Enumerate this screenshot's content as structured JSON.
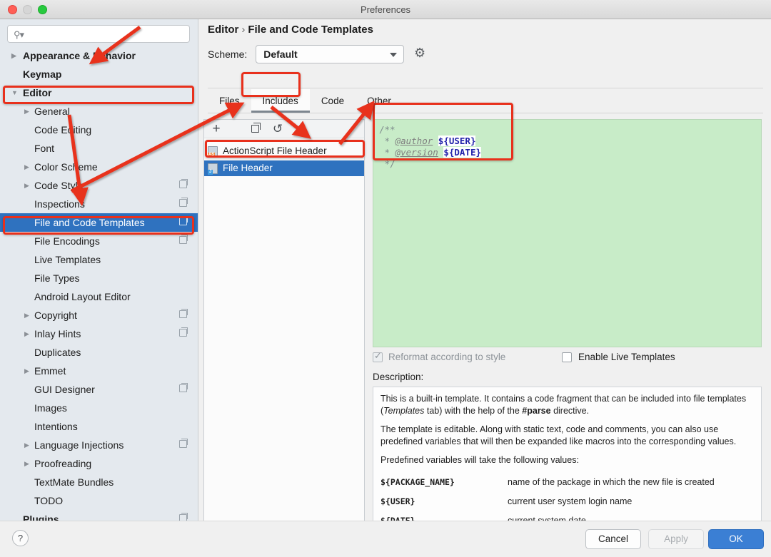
{
  "window": {
    "title": "Preferences",
    "traffic_lights": [
      "close-button",
      "minimize-button",
      "zoom-button"
    ]
  },
  "sidebar": {
    "search": {
      "value": "",
      "placeholder": "",
      "icon": "search-icon"
    },
    "items": [
      {
        "label": "Appearance & Behavior",
        "level": 0,
        "arrow": "collapsed",
        "bold": true,
        "selected": false,
        "copyable": false
      },
      {
        "label": "Keymap",
        "level": 0,
        "arrow": "none",
        "bold": true,
        "selected": false,
        "copyable": false
      },
      {
        "label": "Editor",
        "level": 0,
        "arrow": "expanded",
        "bold": true,
        "selected": false,
        "copyable": false
      },
      {
        "label": "General",
        "level": 1,
        "arrow": "collapsed",
        "bold": false,
        "selected": false,
        "copyable": false
      },
      {
        "label": "Code Editing",
        "level": 1,
        "arrow": "none",
        "bold": false,
        "selected": false,
        "copyable": false
      },
      {
        "label": "Font",
        "level": 1,
        "arrow": "none",
        "bold": false,
        "selected": false,
        "copyable": false
      },
      {
        "label": "Color Scheme",
        "level": 1,
        "arrow": "collapsed",
        "bold": false,
        "selected": false,
        "copyable": false
      },
      {
        "label": "Code Style",
        "level": 1,
        "arrow": "collapsed",
        "bold": false,
        "selected": false,
        "copyable": true
      },
      {
        "label": "Inspections",
        "level": 1,
        "arrow": "none",
        "bold": false,
        "selected": false,
        "copyable": true
      },
      {
        "label": "File and Code Templates",
        "level": 1,
        "arrow": "none",
        "bold": false,
        "selected": true,
        "copyable": true
      },
      {
        "label": "File Encodings",
        "level": 1,
        "arrow": "none",
        "bold": false,
        "selected": false,
        "copyable": true
      },
      {
        "label": "Live Templates",
        "level": 1,
        "arrow": "none",
        "bold": false,
        "selected": false,
        "copyable": false
      },
      {
        "label": "File Types",
        "level": 1,
        "arrow": "none",
        "bold": false,
        "selected": false,
        "copyable": false
      },
      {
        "label": "Android Layout Editor",
        "level": 1,
        "arrow": "none",
        "bold": false,
        "selected": false,
        "copyable": false
      },
      {
        "label": "Copyright",
        "level": 1,
        "arrow": "collapsed",
        "bold": false,
        "selected": false,
        "copyable": true
      },
      {
        "label": "Inlay Hints",
        "level": 1,
        "arrow": "collapsed",
        "bold": false,
        "selected": false,
        "copyable": true
      },
      {
        "label": "Duplicates",
        "level": 1,
        "arrow": "none",
        "bold": false,
        "selected": false,
        "copyable": false
      },
      {
        "label": "Emmet",
        "level": 1,
        "arrow": "collapsed",
        "bold": false,
        "selected": false,
        "copyable": false
      },
      {
        "label": "GUI Designer",
        "level": 1,
        "arrow": "none",
        "bold": false,
        "selected": false,
        "copyable": true
      },
      {
        "label": "Images",
        "level": 1,
        "arrow": "none",
        "bold": false,
        "selected": false,
        "copyable": false
      },
      {
        "label": "Intentions",
        "level": 1,
        "arrow": "none",
        "bold": false,
        "selected": false,
        "copyable": false
      },
      {
        "label": "Language Injections",
        "level": 1,
        "arrow": "collapsed",
        "bold": false,
        "selected": false,
        "copyable": true
      },
      {
        "label": "Proofreading",
        "level": 1,
        "arrow": "collapsed",
        "bold": false,
        "selected": false,
        "copyable": false
      },
      {
        "label": "TextMate Bundles",
        "level": 1,
        "arrow": "none",
        "bold": false,
        "selected": false,
        "copyable": false
      },
      {
        "label": "TODO",
        "level": 1,
        "arrow": "none",
        "bold": false,
        "selected": false,
        "copyable": false
      },
      {
        "label": "Plugins",
        "level": 0,
        "arrow": "none",
        "bold": true,
        "selected": false,
        "copyable": true
      }
    ]
  },
  "header": {
    "breadcrumb_root": "Editor",
    "breadcrumb_sep": "›",
    "breadcrumb_leaf": "File and Code Templates",
    "scheme_label": "Scheme:",
    "scheme_value": "Default",
    "gear_icon": "gear-icon"
  },
  "tabs": [
    {
      "label": "Files",
      "active": false
    },
    {
      "label": "Includes",
      "active": true
    },
    {
      "label": "Code",
      "active": false
    },
    {
      "label": "Other",
      "active": false
    }
  ],
  "template_list": {
    "toolbar": {
      "add_label": "+",
      "copy_icon": "copy-icon",
      "revert_label": "↺"
    },
    "rows": [
      {
        "label": "ActionScript File Header",
        "icon": "actionscript-file-icon",
        "selected": false
      },
      {
        "label": "File Header",
        "icon": "java-file-icon",
        "selected": true
      }
    ]
  },
  "editor": {
    "background_color": "#c8ecc8",
    "lines": [
      {
        "plain": "/**"
      },
      {
        "prefix": " * ",
        "tag": "@author",
        "space": " ",
        "var": "${USER}"
      },
      {
        "prefix": " * ",
        "tag": "@version",
        "space": " ",
        "var": "${DATE}"
      },
      {
        "plain": " */"
      }
    ]
  },
  "options": {
    "reformat": {
      "label": "Reformat according to style",
      "checked": true,
      "disabled": true
    },
    "live_templates": {
      "label": "Enable Live Templates",
      "checked": false,
      "disabled": false
    }
  },
  "description": {
    "label": "Description:",
    "para1_a": "This is a built-in template. It contains a code fragment that can be included into file templates (",
    "para1_em": "Templates",
    "para1_b": " tab) with the help of the ",
    "para1_strong": "#parse",
    "para1_c": " directive.",
    "para2": "The template is editable. Along with static text, code and comments, you can also use predefined variables that will then be expanded like macros into the corresponding values.",
    "para3": "Predefined variables will take the following values:",
    "variables": [
      {
        "name": "${PACKAGE_NAME}",
        "desc": "name of the package in which the new file is created"
      },
      {
        "name": "${USER}",
        "desc": "current user system login name"
      },
      {
        "name": "${DATE}",
        "desc": "current system date"
      }
    ]
  },
  "footer": {
    "help_label": "?",
    "cancel_label": "Cancel",
    "apply_label": "Apply",
    "ok_label": "OK"
  },
  "annotations": {
    "color": "#e8301c",
    "boxes": [
      "editor-sidebar-item-highlight",
      "file-and-code-templates-highlight",
      "includes-tab-highlight",
      "file-header-row-highlight",
      "code-editor-highlight"
    ],
    "arrows": [
      "arrow-to-appearance-behavior",
      "arrow-to-inspections",
      "arrow-to-add-button",
      "arrow-to-actionscript-file-header",
      "arrow-to-editor-panel"
    ]
  }
}
